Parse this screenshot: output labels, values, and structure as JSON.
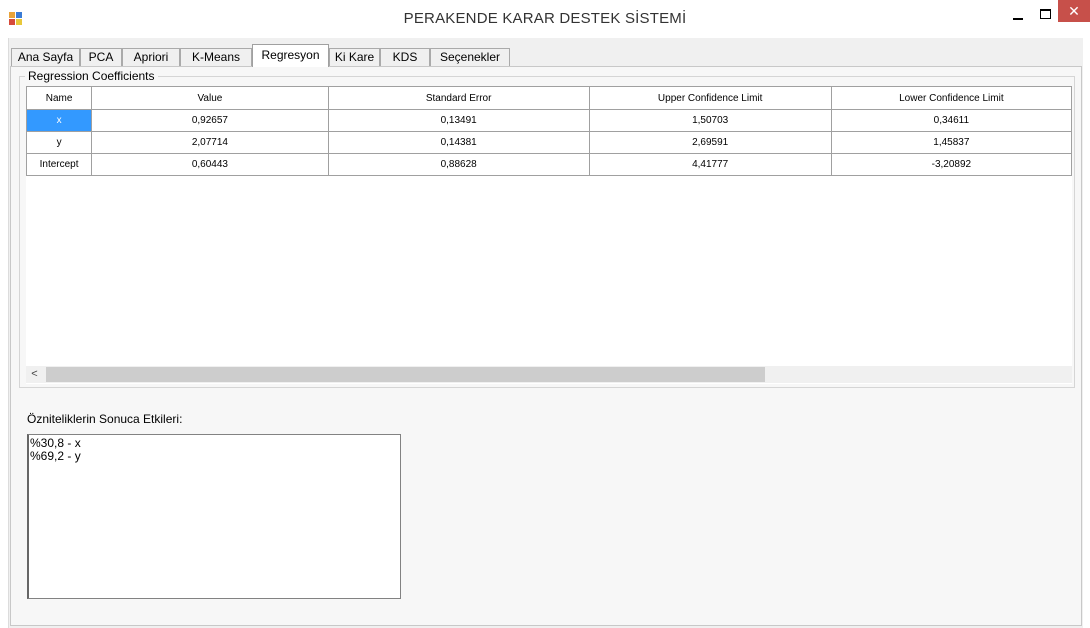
{
  "window": {
    "title": "PERAKENDE KARAR DESTEK SİSTEMİ",
    "icon": "app-grid-icon",
    "close_glyph": "✕"
  },
  "tabs": [
    {
      "label": "Ana Sayfa"
    },
    {
      "label": "PCA"
    },
    {
      "label": "Apriori"
    },
    {
      "label": "K-Means"
    },
    {
      "label": "Regresyon",
      "active": true
    },
    {
      "label": "Ki Kare"
    },
    {
      "label": "KDS"
    },
    {
      "label": "Seçenekler"
    }
  ],
  "coefficients": {
    "group_title": "Regression Coefficients",
    "headers": [
      "Name",
      "Value",
      "Standard Error",
      "Upper Confidence Limit",
      "Lower Confidence Limit"
    ],
    "rows": [
      [
        "x",
        "0,92657",
        "0,13491",
        "1,50703",
        "0,34611"
      ],
      [
        "y",
        "2,07714",
        "0,14381",
        "2,69591",
        "1,45837"
      ],
      [
        "Intercept",
        "0,60443",
        "0,88628",
        "4,41777",
        "-3,20892"
      ]
    ],
    "scroll_left_glyph": "<"
  },
  "effects": {
    "label": "Özniteliklerin Sonuca Etkileri:",
    "text": "%30,8 - x\n%69,2 - y"
  },
  "colors": {
    "selection": "#3399ff",
    "close_button": "#c7504a"
  }
}
